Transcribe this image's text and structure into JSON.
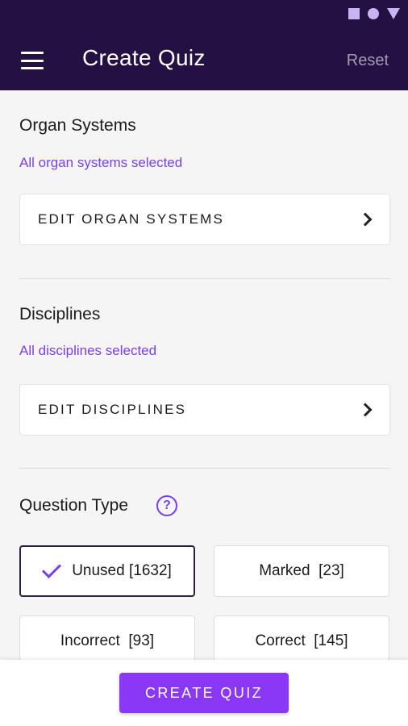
{
  "header": {
    "title": "Create Quiz",
    "reset_label": "Reset"
  },
  "organ_systems": {
    "title": "Organ Systems",
    "subtitle": "All organ systems selected",
    "edit_label": "EDIT ORGAN SYSTEMS"
  },
  "disciplines": {
    "title": "Disciplines",
    "subtitle": "All disciplines selected",
    "edit_label": "EDIT DISCIPLINES"
  },
  "question_type": {
    "title": "Question Type",
    "help_symbol": "?",
    "options": [
      {
        "label": "Unused [1632]",
        "selected": true
      },
      {
        "label": "Marked  [23]",
        "selected": false
      },
      {
        "label": "Incorrect  [93]",
        "selected": false
      },
      {
        "label": "Correct  [145]",
        "selected": false
      }
    ]
  },
  "footer": {
    "create_label": "CREATE QUIZ"
  },
  "colors": {
    "appbar": "#241043",
    "accent": "#7a3ff0",
    "button": "#8a38f5"
  },
  "icons": {
    "menu": "hamburger-icon",
    "chevron": "chevron-right-icon",
    "check": "check-icon",
    "help": "help-circle-icon"
  }
}
